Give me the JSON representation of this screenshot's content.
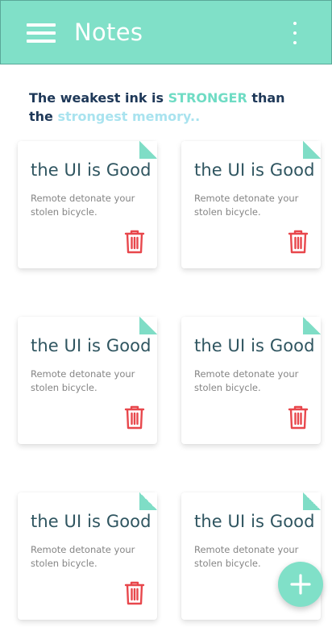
{
  "appbar": {
    "title": "Notes",
    "menu_icon": "hamburger-menu-icon",
    "more_icon": "more-vertical-icon"
  },
  "quote": {
    "part1": "The weakest ink is ",
    "highlight1": "STRONGER",
    "part2": " than the ",
    "highlight2": "strongest memory.."
  },
  "notes": [
    {
      "title": "the UI is Good",
      "body": "Remote detonate your stolen bicycle."
    },
    {
      "title": "the UI is Good",
      "body": "Remote detonate your stolen bicycle."
    },
    {
      "title": "the UI is Good",
      "body": "Remote detonate your stolen bicycle."
    },
    {
      "title": "the UI is Good",
      "body": "Remote detonate your stolen bicycle."
    },
    {
      "title": "the UI is Good",
      "body": "Remote detonate your stolen bicycle."
    },
    {
      "title": "the UI is Good",
      "body": "Remote detonate your stolen bicycle."
    }
  ],
  "fab": {
    "icon": "plus-icon"
  },
  "colors": {
    "accent": "#80e0c8",
    "delete": "#e8474c",
    "title_text": "#2f5560",
    "quote_text": "#1e3858"
  }
}
